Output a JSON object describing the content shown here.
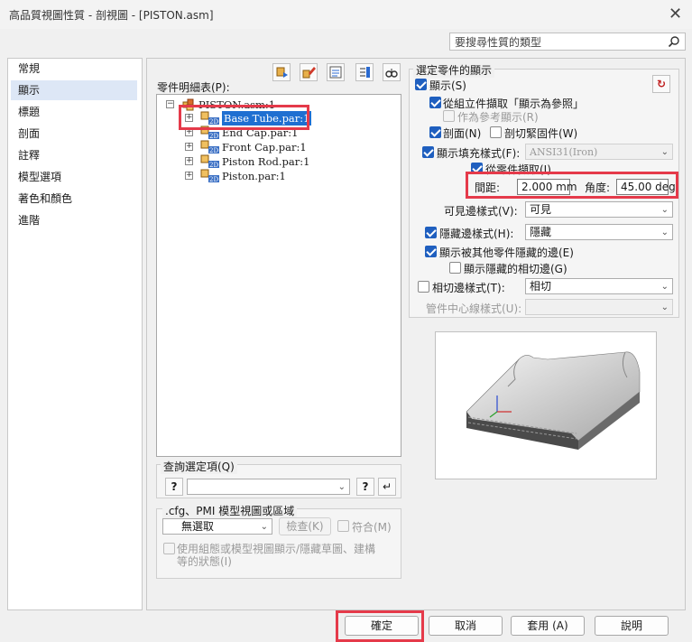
{
  "window": {
    "title": "高品質視圖性質 - 剖視圖 - [PISTON.asm]"
  },
  "search": {
    "placeholder": "要搜尋性質的類型"
  },
  "nav": {
    "items": [
      "常規",
      "顯示",
      "標題",
      "剖面",
      "註釋",
      "模型選項",
      "著色和顏色",
      "進階"
    ],
    "selected_index": 1
  },
  "parts_list": {
    "label": "零件明細表(P):",
    "root": "PISTON.asm:1",
    "items": [
      "Base Tube.par:1",
      "End Cap.par:1",
      "Front Cap.par:1",
      "Piston Rod.par:1",
      "Piston.par:1"
    ],
    "selected_index": 0
  },
  "selected_display": {
    "group_label": "選定零件的顯示",
    "show_label": "顯示(S)",
    "from_assembly_label": "從組立件擷取「顯示為參照」",
    "as_reference_label": "作為參考顯示(R)",
    "section_label": "剖面(N)",
    "section_fasteners_label": "剖切緊固件(W)",
    "fill_style_label": "顯示填充樣式(F):",
    "fill_style_value": "ANSI31(Iron)",
    "from_part_label": "從零件擷取(I)",
    "spacing_label": "間距:",
    "spacing_value": "2.000 mm",
    "angle_label": "角度:",
    "angle_value": "45.00 deg",
    "visible_edge_label": "可見邊樣式(V):",
    "visible_edge_value": "可見",
    "hidden_edge_label": "隱藏邊樣式(H):",
    "hidden_edge_value": "隱藏",
    "show_hidden_by_others_label": "顯示被其他零件隱藏的邊(E)",
    "show_hidden_tangent_label": "顯示隱藏的相切邊(G)",
    "tangent_edge_label": "相切邊樣式(T):",
    "tangent_edge_value": "相切",
    "pipe_centerline_label": "管件中心線樣式(U):"
  },
  "query": {
    "label": "查詢選定項(Q)"
  },
  "cfg": {
    "label": ".cfg、PMI 模型視圖或區域",
    "select_value": "無選取",
    "check_button": "檢查(K)",
    "match_label": "符合(M)",
    "use_config_label_line1": "使用組態或模型視圖顯示/隱藏草圖、建構",
    "use_config_label_line2": "等的狀態(I)"
  },
  "footer": {
    "ok": "確定",
    "cancel": "取消",
    "apply": "套用 (A)",
    "help": "說明"
  }
}
